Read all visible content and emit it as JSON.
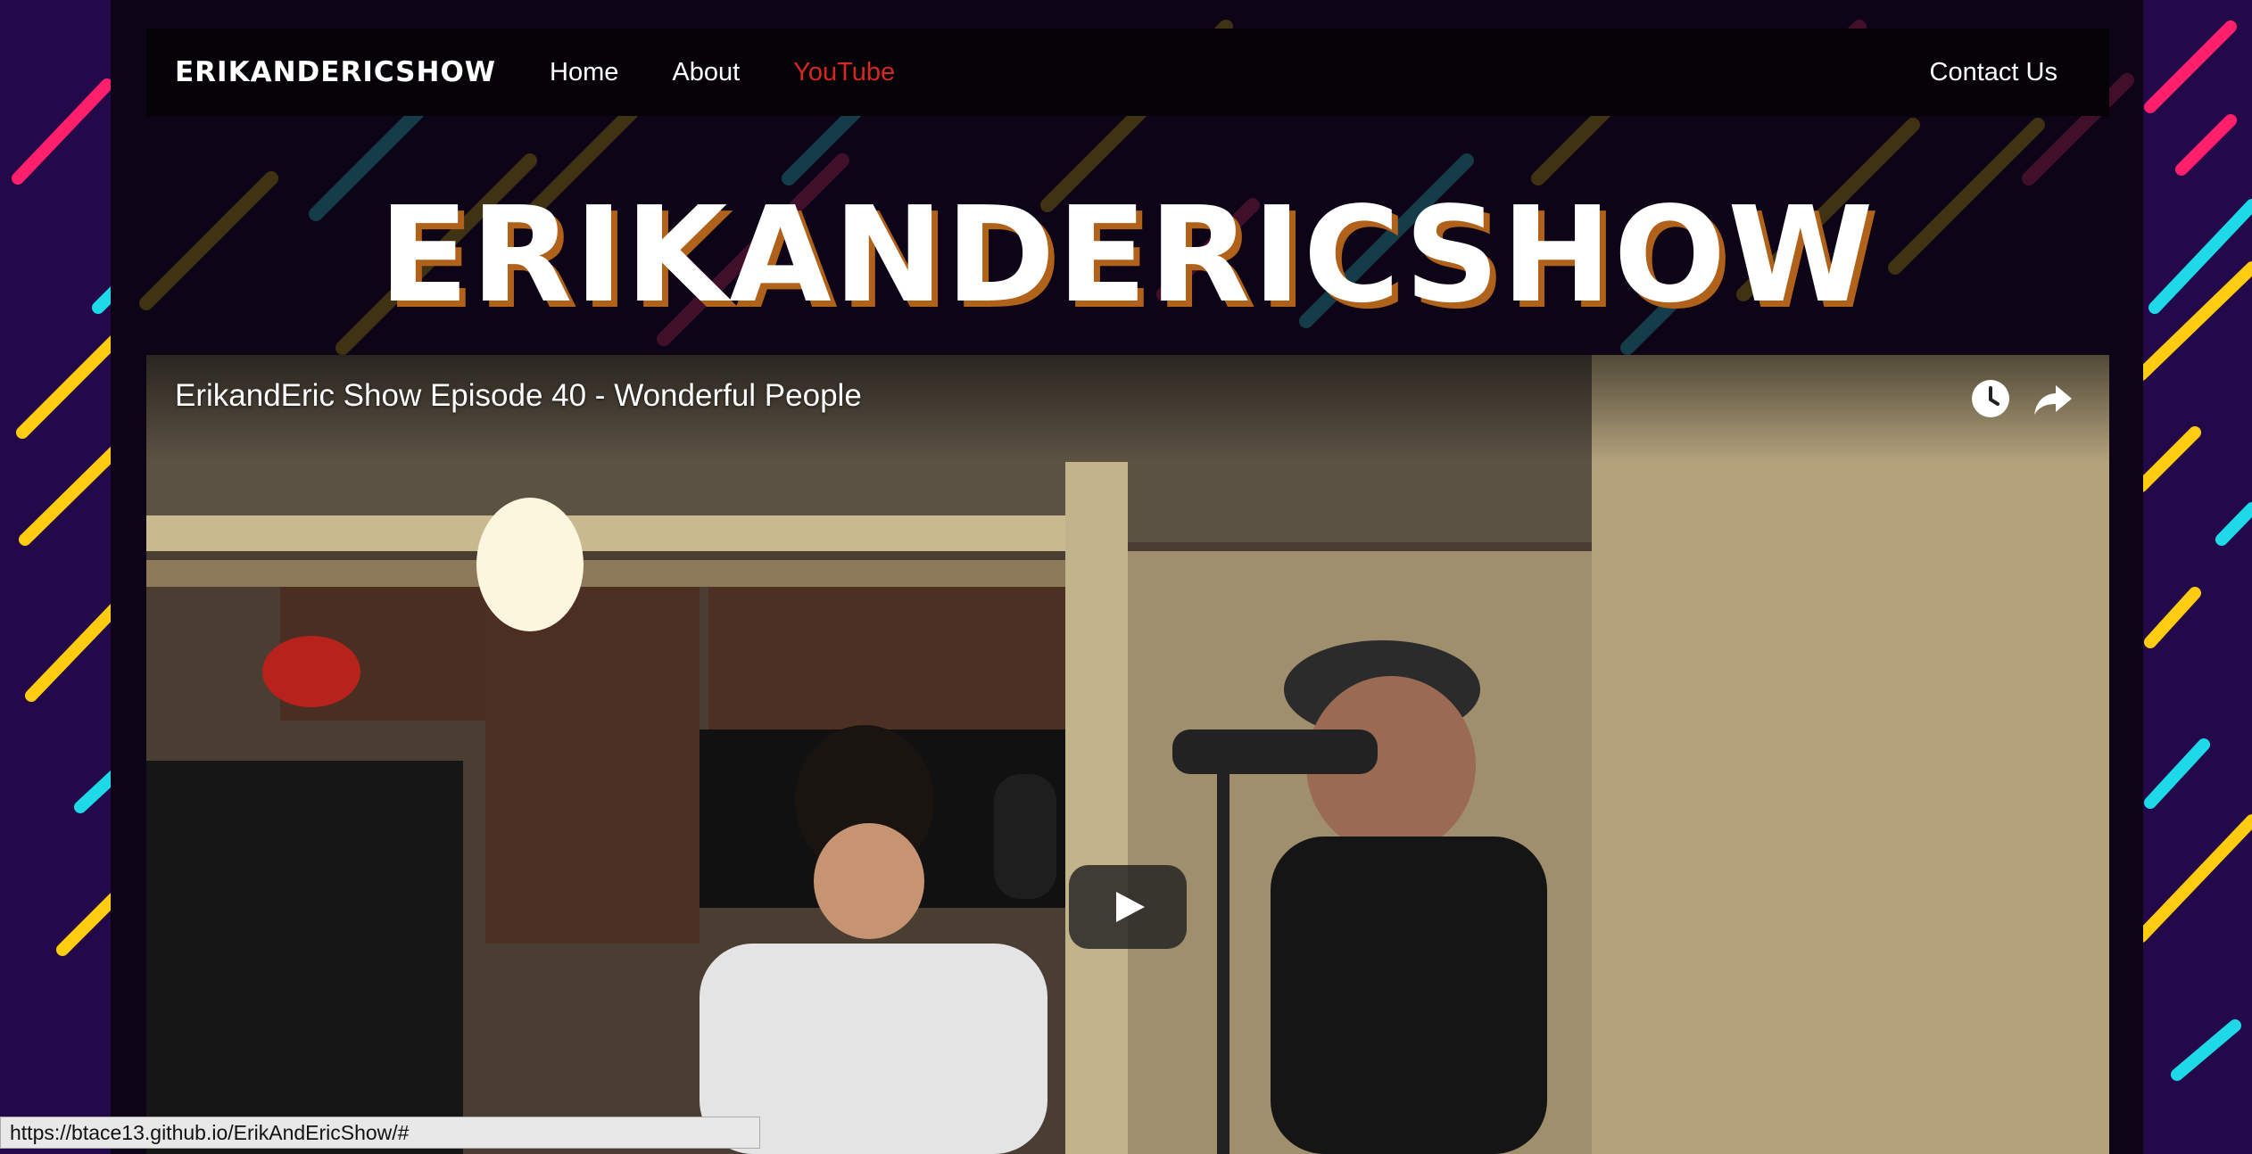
{
  "nav": {
    "brand": "ERIKANDERICSHOW",
    "links": [
      {
        "label": "Home"
      },
      {
        "label": "About"
      },
      {
        "label": "YouTube",
        "active": true
      }
    ],
    "contact": "Contact Us"
  },
  "hero": {
    "title": "ERIKANDERICSHOW"
  },
  "video": {
    "title": "ErikandEric Show Episode 40 - Wonderful People",
    "controls": [
      "watch-later-icon",
      "share-icon",
      "play-icon"
    ]
  },
  "status_bar": {
    "url": "https://btace13.github.io/ErikAndEricShow/#"
  },
  "colors": {
    "background": "#23094a",
    "page": "#0e0418",
    "navbar": "#050208",
    "active_link": "#d6281e",
    "title_shadow": "#b0611a",
    "stripe_pink": "#ff1f6b",
    "stripe_yellow": "#ffcc11",
    "stripe_cyan": "#1ed9e8"
  }
}
